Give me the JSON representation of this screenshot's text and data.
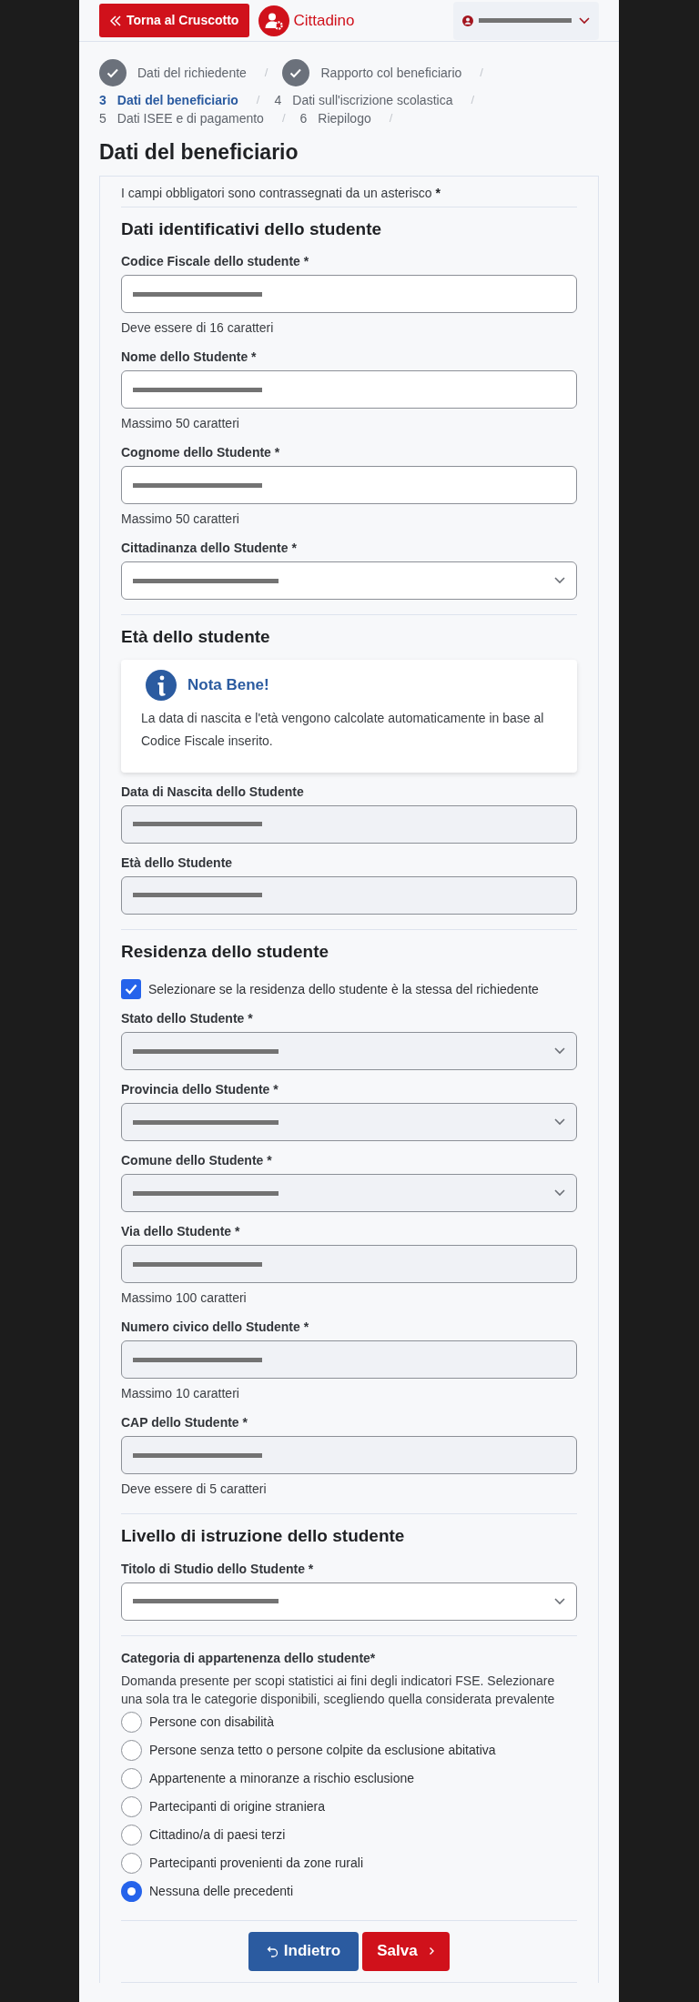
{
  "header": {
    "back_button": "Torna al Cruscotto",
    "role": "Cittadino",
    "user_menu": {
      "redacted": true
    }
  },
  "steps": [
    {
      "label": "Dati del richiedente",
      "completed": true,
      "selected": false,
      "separator": "/"
    },
    {
      "label": "Rapporto col beneficiario",
      "completed": true,
      "selected": false,
      "separator": "/"
    },
    {
      "number": "3",
      "label": "Dati del beneficiario",
      "completed": false,
      "selected": true,
      "separator": "/"
    },
    {
      "number": "4",
      "label": "Dati sull'iscrizione scolastica",
      "completed": false,
      "selected": false,
      "separator": "/"
    },
    {
      "number": "5",
      "label": "Dati ISEE e di pagamento",
      "completed": false,
      "selected": false,
      "separator": "/"
    },
    {
      "number": "6",
      "label": "Riepilogo",
      "completed": false,
      "selected": false,
      "separator": "/"
    }
  ],
  "page_title": "Dati del beneficiario",
  "required_note": "I campi obbligatori sono contrassegnati da un asterisco",
  "required_mark": "*",
  "sections": [
    {
      "title": "Dati identificativi dello studente",
      "items": [
        {
          "kind": "input",
          "label": "Codice Fiscale dello studente *",
          "disabled": false,
          "redacted": true,
          "hint": "Deve essere di 16 caratteri"
        },
        {
          "kind": "input",
          "label": "Nome dello Studente *",
          "disabled": false,
          "redacted": true,
          "hint": "Massimo 50 caratteri"
        },
        {
          "kind": "input",
          "label": "Cognome dello Studente *",
          "disabled": false,
          "redacted": true,
          "hint": "Massimo 50 caratteri"
        },
        {
          "kind": "select",
          "label": "Cittadinanza dello Studente *",
          "disabled": false,
          "redacted": true
        }
      ]
    },
    {
      "title": "Età dello studente",
      "items": [
        {
          "kind": "note",
          "title": "Nota Bene!",
          "text": "La data di nascita e l'età vengono calcolate automaticamente in base al Codice Fiscale inserito."
        },
        {
          "kind": "input",
          "label": "Data di Nascita dello Studente",
          "disabled": true,
          "redacted": true
        },
        {
          "kind": "input",
          "label": "Età dello Studente",
          "disabled": true,
          "redacted": true
        }
      ]
    },
    {
      "title": "Residenza dello studente",
      "items": [
        {
          "kind": "checkbox",
          "label": "Selezionare se la residenza dello studente è la stessa del richiedente",
          "checked": true
        },
        {
          "kind": "select",
          "label": "Stato dello Studente *",
          "disabled": true,
          "redacted": true
        },
        {
          "kind": "select",
          "label": "Provincia dello Studente *",
          "disabled": true,
          "redacted": true
        },
        {
          "kind": "select",
          "label": "Comune dello Studente *",
          "disabled": true,
          "redacted": true
        },
        {
          "kind": "input",
          "label": "Via dello Studente *",
          "disabled": true,
          "redacted": true,
          "hint": "Massimo 100 caratteri"
        },
        {
          "kind": "input",
          "label": "Numero civico dello Studente *",
          "disabled": true,
          "redacted": true,
          "hint": "Massimo 10 caratteri"
        },
        {
          "kind": "input",
          "label": "CAP dello Studente *",
          "disabled": true,
          "redacted": true,
          "hint": "Deve essere di 5 caratteri"
        }
      ]
    },
    {
      "title": "Livello di istruzione dello studente",
      "items": [
        {
          "kind": "select",
          "label": "Titolo di Studio dello Studente *",
          "disabled": false,
          "redacted": true
        }
      ]
    },
    {
      "items": [
        {
          "kind": "radio_group",
          "label": "Categoria di appartenenza dello studente*",
          "description": "Domanda presente per scopi statistici ai fini degli indicatori FSE. Selezionare una sola tra le categorie disponibili, scegliendo quella considerata prevalente",
          "options": [
            {
              "label": "Persone con disabilità",
              "selected": false
            },
            {
              "label": "Persone senza tetto o persone colpite da esclusione abitativa",
              "selected": false
            },
            {
              "label": "Appartenente a minoranze a rischio esclusione",
              "selected": false
            },
            {
              "label": "Partecipanti di origine straniera",
              "selected": false
            },
            {
              "label": "Cittadino/a di paesi terzi",
              "selected": false
            },
            {
              "label": "Partecipanti provenienti da zone rurali",
              "selected": false
            },
            {
              "label": "Nessuna delle precedenti",
              "selected": true
            }
          ]
        }
      ]
    }
  ],
  "buttons": [
    {
      "kind": "back",
      "label": "Indietro"
    },
    {
      "kind": "save",
      "label": "Salva"
    }
  ]
}
